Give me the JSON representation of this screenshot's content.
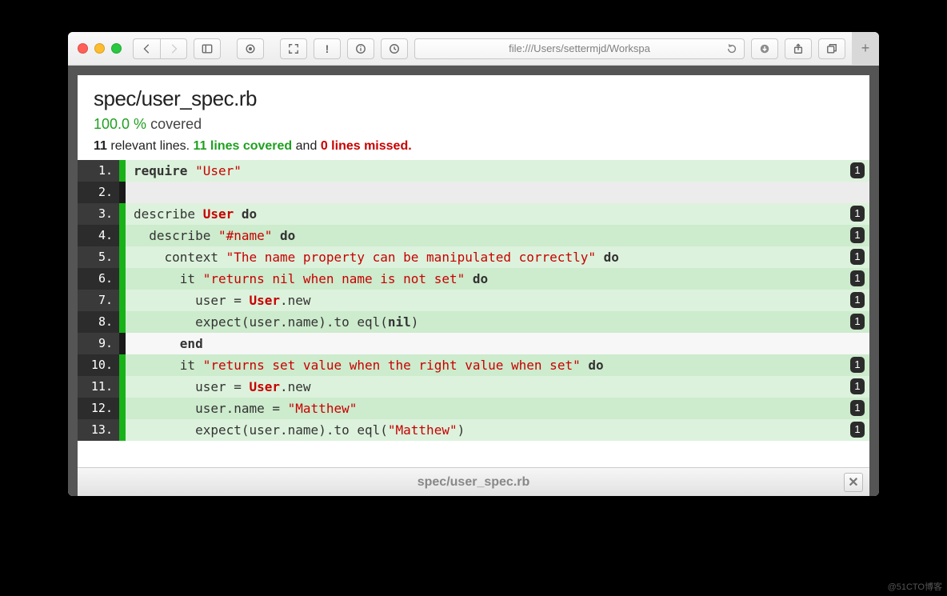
{
  "browser": {
    "url": "file:///Users/settermjd/Workspa"
  },
  "header": {
    "file_path": "spec/user_spec.rb",
    "coverage_pct": "100.0 %",
    "coverage_label": "covered",
    "relevant_count": "11",
    "relevant_label": "relevant lines.",
    "covered_count": "11",
    "covered_label": "lines covered",
    "and_label": "and",
    "missed_count": "0",
    "missed_label": "lines missed."
  },
  "footer": {
    "file_path": "spec/user_spec.rb"
  },
  "code": {
    "lines": [
      {
        "n": "1.",
        "status": "covered",
        "hits": "1",
        "tokens": [
          [
            "kw",
            "require"
          ],
          [
            "pl",
            " "
          ],
          [
            "str",
            "\"User\""
          ]
        ]
      },
      {
        "n": "2.",
        "status": "skipped",
        "hits": null,
        "tokens": [
          [
            "pl",
            ""
          ]
        ]
      },
      {
        "n": "3.",
        "status": "covered",
        "hits": "1",
        "tokens": [
          [
            "pl",
            "describe "
          ],
          [
            "const",
            "User"
          ],
          [
            "pl",
            " "
          ],
          [
            "kw",
            "do"
          ]
        ]
      },
      {
        "n": "4.",
        "status": "covered",
        "hits": "1",
        "tokens": [
          [
            "pl",
            "  describe "
          ],
          [
            "str",
            "\"#name\""
          ],
          [
            "pl",
            " "
          ],
          [
            "kw",
            "do"
          ]
        ]
      },
      {
        "n": "5.",
        "status": "covered",
        "hits": "1",
        "tokens": [
          [
            "pl",
            "    context "
          ],
          [
            "str",
            "\"The name property can be manipulated correctly\""
          ],
          [
            "pl",
            " "
          ],
          [
            "kw",
            "do"
          ]
        ]
      },
      {
        "n": "6.",
        "status": "covered",
        "hits": "1",
        "tokens": [
          [
            "pl",
            "      it "
          ],
          [
            "str",
            "\"returns nil when name is not set\""
          ],
          [
            "pl",
            " "
          ],
          [
            "kw",
            "do"
          ]
        ]
      },
      {
        "n": "7.",
        "status": "covered",
        "hits": "1",
        "tokens": [
          [
            "pl",
            "        user = "
          ],
          [
            "const",
            "User"
          ],
          [
            "pl",
            ".new"
          ]
        ]
      },
      {
        "n": "8.",
        "status": "covered",
        "hits": "1",
        "tokens": [
          [
            "pl",
            "        expect(user.name).to eql("
          ],
          [
            "kw",
            "nil"
          ],
          [
            "pl",
            ")"
          ]
        ]
      },
      {
        "n": "9.",
        "status": "skipped",
        "hits": null,
        "tokens": [
          [
            "pl",
            "      "
          ],
          [
            "kw",
            "end"
          ]
        ]
      },
      {
        "n": "10.",
        "status": "covered",
        "hits": "1",
        "tokens": [
          [
            "pl",
            "      it "
          ],
          [
            "str",
            "\"returns set value when the right value when set\""
          ],
          [
            "pl",
            " "
          ],
          [
            "kw",
            "do"
          ]
        ]
      },
      {
        "n": "11.",
        "status": "covered",
        "hits": "1",
        "tokens": [
          [
            "pl",
            "        user = "
          ],
          [
            "const",
            "User"
          ],
          [
            "pl",
            ".new"
          ]
        ]
      },
      {
        "n": "12.",
        "status": "covered",
        "hits": "1",
        "tokens": [
          [
            "pl",
            "        user.name = "
          ],
          [
            "str",
            "\"Matthew\""
          ]
        ]
      },
      {
        "n": "13.",
        "status": "covered",
        "hits": "1",
        "tokens": [
          [
            "pl",
            "        expect(user.name).to eql("
          ],
          [
            "str",
            "\"Matthew\""
          ],
          [
            "pl",
            ")"
          ]
        ]
      }
    ]
  },
  "watermark": "@51CTO博客"
}
